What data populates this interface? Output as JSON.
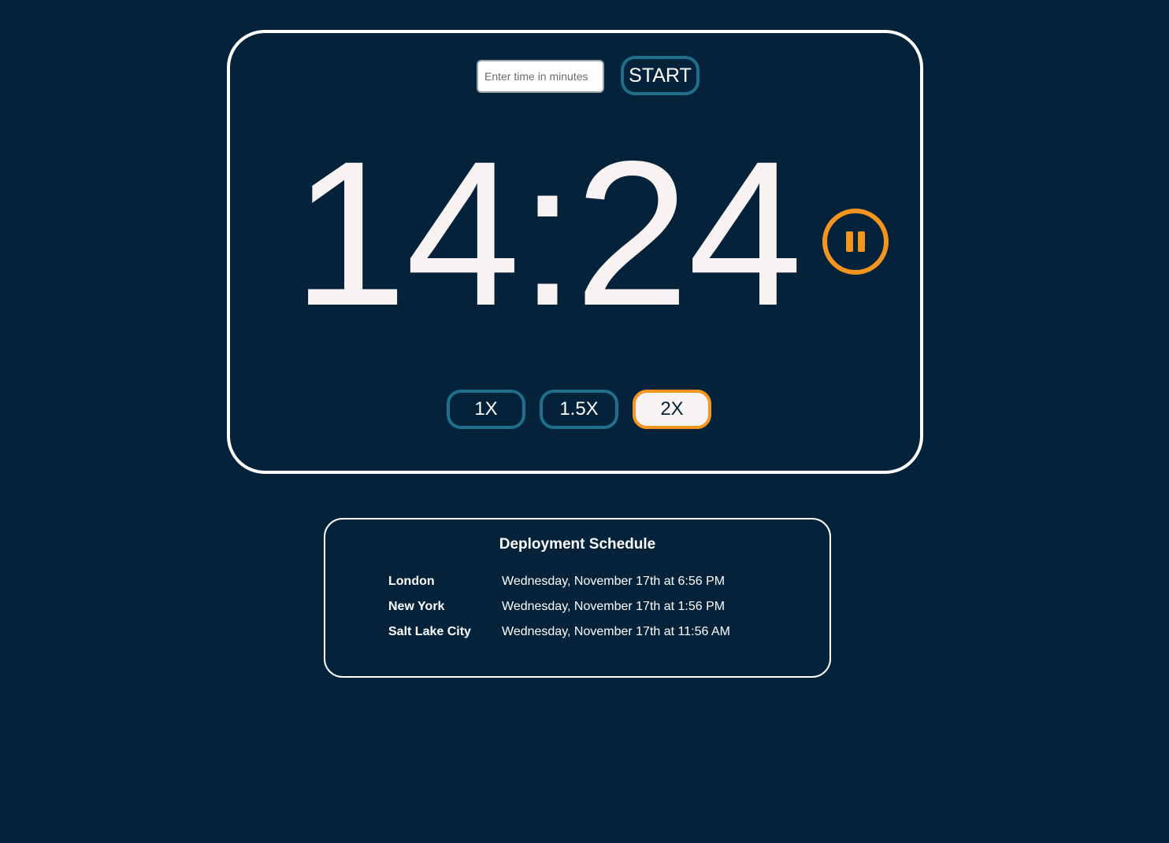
{
  "timer": {
    "input_placeholder": "Enter time in minutes",
    "input_value": "",
    "start_label": "START",
    "countdown": "14:24",
    "pause_icon": "pause-icon",
    "speed_options": [
      {
        "label": "1X",
        "active": false
      },
      {
        "label": "1.5X",
        "active": false
      },
      {
        "label": "2X",
        "active": true
      }
    ]
  },
  "schedule": {
    "title": "Deployment Schedule",
    "rows": [
      {
        "city": "London",
        "time": "Wednesday, November 17th at 6:56 PM"
      },
      {
        "city": "New York",
        "time": "Wednesday, November 17th at 1:56 PM"
      },
      {
        "city": "Salt Lake City",
        "time": "Wednesday, November 17th at 11:56 AM"
      }
    ]
  },
  "colors": {
    "background": "#04233a",
    "accent_orange": "#f5951f",
    "accent_teal": "#1f6f8b",
    "text_light": "#f8f2f2"
  }
}
